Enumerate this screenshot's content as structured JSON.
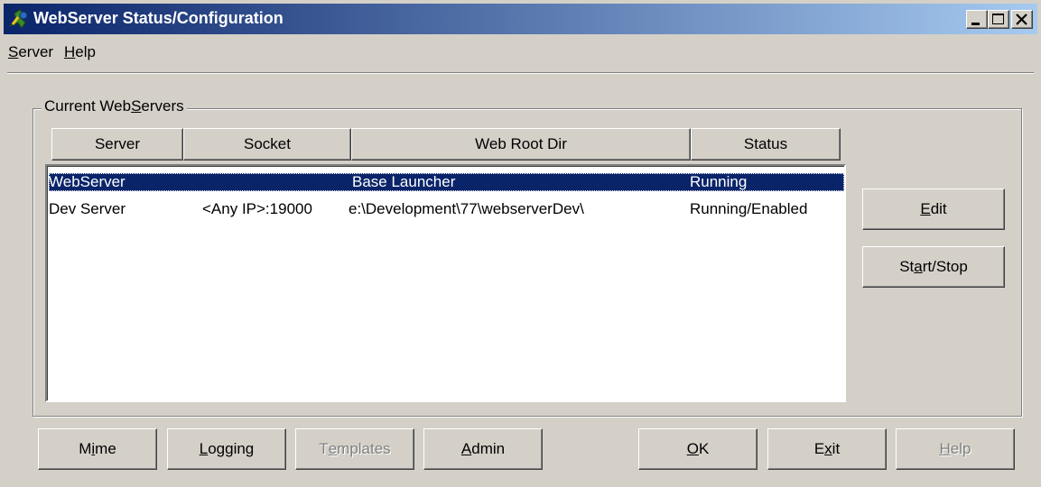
{
  "window": {
    "title": "WebServer Status/Configuration",
    "icon": "webserver-app-icon"
  },
  "menu": {
    "server": {
      "prefix": "",
      "accel": "S",
      "rest": "erver"
    },
    "help": {
      "prefix": "",
      "accel": "H",
      "rest": "elp"
    }
  },
  "group": {
    "label_prefix": "Current Web",
    "label_accel": "S",
    "label_rest": "ervers"
  },
  "columns": [
    "Server",
    "Socket",
    "Web Root Dir",
    "Status"
  ],
  "rows": [
    {
      "server": "WebServer",
      "socket": "",
      "root": "Base Launcher",
      "status": "Running",
      "selected": true
    },
    {
      "server": "Dev Server",
      "socket": "<Any IP>:19000",
      "root": "e:\\Development\\77\\webserverDev\\",
      "status": "Running/Enabled",
      "selected": false
    }
  ],
  "side_buttons": {
    "edit": {
      "prefix": "",
      "accel": "E",
      "rest": "dit"
    },
    "startstop": {
      "prefix": "St",
      "accel": "a",
      "rest": "rt/Stop"
    }
  },
  "bottom_buttons": {
    "mime": {
      "prefix": "M",
      "accel": "i",
      "rest": "me"
    },
    "logging": {
      "prefix": "",
      "accel": "L",
      "rest": "ogging"
    },
    "templates": {
      "prefix": "T",
      "accel": "e",
      "rest": "mplates"
    },
    "admin": {
      "prefix": "",
      "accel": "A",
      "rest": "dmin"
    },
    "ok": {
      "prefix": "",
      "accel": "O",
      "rest": "K"
    },
    "exit": {
      "prefix": "E",
      "accel": "x",
      "rest": "it"
    },
    "help": {
      "prefix": "",
      "accel": "H",
      "rest": "elp"
    }
  },
  "colors": {
    "title_start": "#0a246a",
    "title_end": "#a6caf0",
    "selection": "#0a246a",
    "face": "#d4d0c8"
  }
}
